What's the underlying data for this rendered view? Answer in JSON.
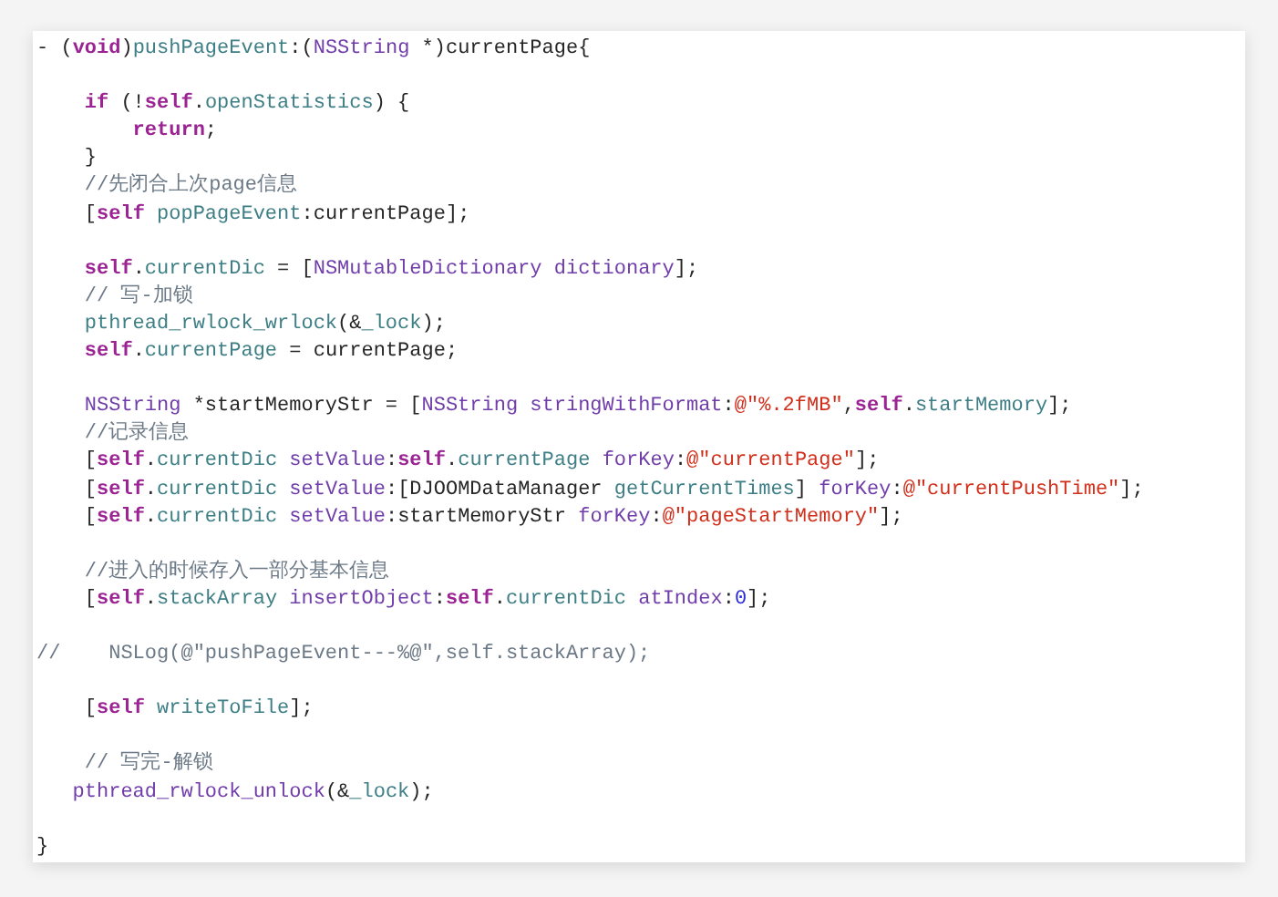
{
  "code_lines": [
    {
      "kind": "code",
      "tokens": [
        {
          "kind": "plain",
          "text": "- ("
        },
        {
          "kind": "keyword",
          "text": "void"
        },
        {
          "kind": "plain",
          "text": ")"
        },
        {
          "kind": "method",
          "text": "pushPageEvent"
        },
        {
          "kind": "plain",
          "text": ":("
        },
        {
          "kind": "class",
          "text": "NSString"
        },
        {
          "kind": "plain",
          "text": " *)currentPage{"
        }
      ]
    },
    {
      "kind": "blank"
    },
    {
      "kind": "code",
      "tokens": [
        {
          "kind": "keyword",
          "text": "    if"
        },
        {
          "kind": "plain",
          "text": " (!"
        },
        {
          "kind": "keyword",
          "text": "self"
        },
        {
          "kind": "plain",
          "text": "."
        },
        {
          "kind": "method",
          "text": "openStatistics"
        },
        {
          "kind": "plain",
          "text": ") {"
        }
      ]
    },
    {
      "kind": "code",
      "tokens": [
        {
          "kind": "keyword",
          "text": "        return"
        },
        {
          "kind": "plain",
          "text": ";"
        }
      ]
    },
    {
      "kind": "code",
      "tokens": [
        {
          "kind": "plain",
          "text": "    }"
        }
      ]
    },
    {
      "kind": "code",
      "tokens": [
        {
          "kind": "comment",
          "text": "    //先闭合上次page信息"
        }
      ]
    },
    {
      "kind": "code",
      "tokens": [
        {
          "kind": "plain",
          "text": "    ["
        },
        {
          "kind": "keyword",
          "text": "self"
        },
        {
          "kind": "method",
          "text": " popPageEvent"
        },
        {
          "kind": "plain",
          "text": ":currentPage];"
        }
      ]
    },
    {
      "kind": "blank"
    },
    {
      "kind": "code",
      "tokens": [
        {
          "kind": "keyword",
          "text": "    self"
        },
        {
          "kind": "plain",
          "text": "."
        },
        {
          "kind": "method",
          "text": "currentDic"
        },
        {
          "kind": "plain",
          "text": " = ["
        },
        {
          "kind": "class",
          "text": "NSMutableDictionary dictionary"
        },
        {
          "kind": "plain",
          "text": "];"
        }
      ]
    },
    {
      "kind": "code",
      "tokens": [
        {
          "kind": "comment",
          "text": "    // 写-加锁"
        }
      ]
    },
    {
      "kind": "code",
      "tokens": [
        {
          "kind": "method",
          "text": "    pthread_rwlock_wrlock"
        },
        {
          "kind": "plain",
          "text": "(&"
        },
        {
          "kind": "method",
          "text": "_lock"
        },
        {
          "kind": "plain",
          "text": ");"
        }
      ]
    },
    {
      "kind": "code",
      "tokens": [
        {
          "kind": "keyword",
          "text": "    self"
        },
        {
          "kind": "plain",
          "text": "."
        },
        {
          "kind": "method",
          "text": "currentPage"
        },
        {
          "kind": "plain",
          "text": " = currentPage;"
        }
      ]
    },
    {
      "kind": "blank"
    },
    {
      "kind": "code",
      "tokens": [
        {
          "kind": "class",
          "text": "    NSString"
        },
        {
          "kind": "plain",
          "text": " *startMemoryStr = ["
        },
        {
          "kind": "class",
          "text": "NSString stringWithFormat"
        },
        {
          "kind": "plain",
          "text": ":"
        },
        {
          "kind": "string",
          "text": "@\"%.2fMB\""
        },
        {
          "kind": "plain",
          "text": ","
        },
        {
          "kind": "keyword",
          "text": "self"
        },
        {
          "kind": "plain",
          "text": "."
        },
        {
          "kind": "method",
          "text": "startMemory"
        },
        {
          "kind": "plain",
          "text": "];"
        }
      ]
    },
    {
      "kind": "code",
      "tokens": [
        {
          "kind": "comment",
          "text": "    //记录信息"
        }
      ]
    },
    {
      "kind": "code",
      "tokens": [
        {
          "kind": "plain",
          "text": "    ["
        },
        {
          "kind": "keyword",
          "text": "self"
        },
        {
          "kind": "plain",
          "text": "."
        },
        {
          "kind": "method",
          "text": "currentDic"
        },
        {
          "kind": "class",
          "text": " setValue"
        },
        {
          "kind": "plain",
          "text": ":"
        },
        {
          "kind": "keyword",
          "text": "self"
        },
        {
          "kind": "plain",
          "text": "."
        },
        {
          "kind": "method",
          "text": "currentPage"
        },
        {
          "kind": "class",
          "text": " forKey"
        },
        {
          "kind": "plain",
          "text": ":"
        },
        {
          "kind": "string",
          "text": "@\"currentPage\""
        },
        {
          "kind": "plain",
          "text": "];"
        }
      ]
    },
    {
      "kind": "code",
      "tokens": [
        {
          "kind": "plain",
          "text": "    ["
        },
        {
          "kind": "keyword",
          "text": "self"
        },
        {
          "kind": "plain",
          "text": "."
        },
        {
          "kind": "method",
          "text": "currentDic"
        },
        {
          "kind": "class",
          "text": " setValue"
        },
        {
          "kind": "plain",
          "text": ":[DJOOMDataManager "
        },
        {
          "kind": "method",
          "text": "getCurrentTimes"
        },
        {
          "kind": "plain",
          "text": "] "
        },
        {
          "kind": "class",
          "text": "forKey"
        },
        {
          "kind": "plain",
          "text": ":"
        },
        {
          "kind": "string",
          "text": "@\"currentPushTime\""
        },
        {
          "kind": "plain",
          "text": "];"
        }
      ]
    },
    {
      "kind": "code",
      "tokens": [
        {
          "kind": "plain",
          "text": "    ["
        },
        {
          "kind": "keyword",
          "text": "self"
        },
        {
          "kind": "plain",
          "text": "."
        },
        {
          "kind": "method",
          "text": "currentDic"
        },
        {
          "kind": "class",
          "text": " setValue"
        },
        {
          "kind": "plain",
          "text": ":startMemoryStr "
        },
        {
          "kind": "class",
          "text": "forKey"
        },
        {
          "kind": "plain",
          "text": ":"
        },
        {
          "kind": "string",
          "text": "@\"pageStartMemory\""
        },
        {
          "kind": "plain",
          "text": "];"
        }
      ]
    },
    {
      "kind": "blank"
    },
    {
      "kind": "code",
      "tokens": [
        {
          "kind": "comment",
          "text": "    //进入的时候存入一部分基本信息"
        }
      ]
    },
    {
      "kind": "code",
      "tokens": [
        {
          "kind": "plain",
          "text": "    ["
        },
        {
          "kind": "keyword",
          "text": "self"
        },
        {
          "kind": "plain",
          "text": "."
        },
        {
          "kind": "method",
          "text": "stackArray"
        },
        {
          "kind": "class",
          "text": " insertObject"
        },
        {
          "kind": "plain",
          "text": ":"
        },
        {
          "kind": "keyword",
          "text": "self"
        },
        {
          "kind": "plain",
          "text": "."
        },
        {
          "kind": "method",
          "text": "currentDic"
        },
        {
          "kind": "class",
          "text": " atIndex"
        },
        {
          "kind": "plain",
          "text": ":"
        },
        {
          "kind": "number",
          "text": "0"
        },
        {
          "kind": "plain",
          "text": "];"
        }
      ]
    },
    {
      "kind": "blank"
    },
    {
      "kind": "code",
      "tokens": [
        {
          "kind": "comment",
          "text": "//    NSLog(@\"pushPageEvent---%@\",self.stackArray);"
        }
      ]
    },
    {
      "kind": "blank"
    },
    {
      "kind": "code",
      "tokens": [
        {
          "kind": "plain",
          "text": "    ["
        },
        {
          "kind": "keyword",
          "text": "self"
        },
        {
          "kind": "method",
          "text": " writeToFile"
        },
        {
          "kind": "plain",
          "text": "];"
        }
      ]
    },
    {
      "kind": "blank"
    },
    {
      "kind": "code",
      "tokens": [
        {
          "kind": "comment",
          "text": "    // 写完-解锁"
        }
      ]
    },
    {
      "kind": "code",
      "tokens": [
        {
          "kind": "class",
          "text": "   pthread_rwlock_unlock"
        },
        {
          "kind": "plain",
          "text": "(&"
        },
        {
          "kind": "method",
          "text": "_lock"
        },
        {
          "kind": "plain",
          "text": ");"
        }
      ]
    },
    {
      "kind": "blank"
    },
    {
      "kind": "code",
      "tokens": [
        {
          "kind": "plain",
          "text": "}"
        }
      ]
    }
  ]
}
